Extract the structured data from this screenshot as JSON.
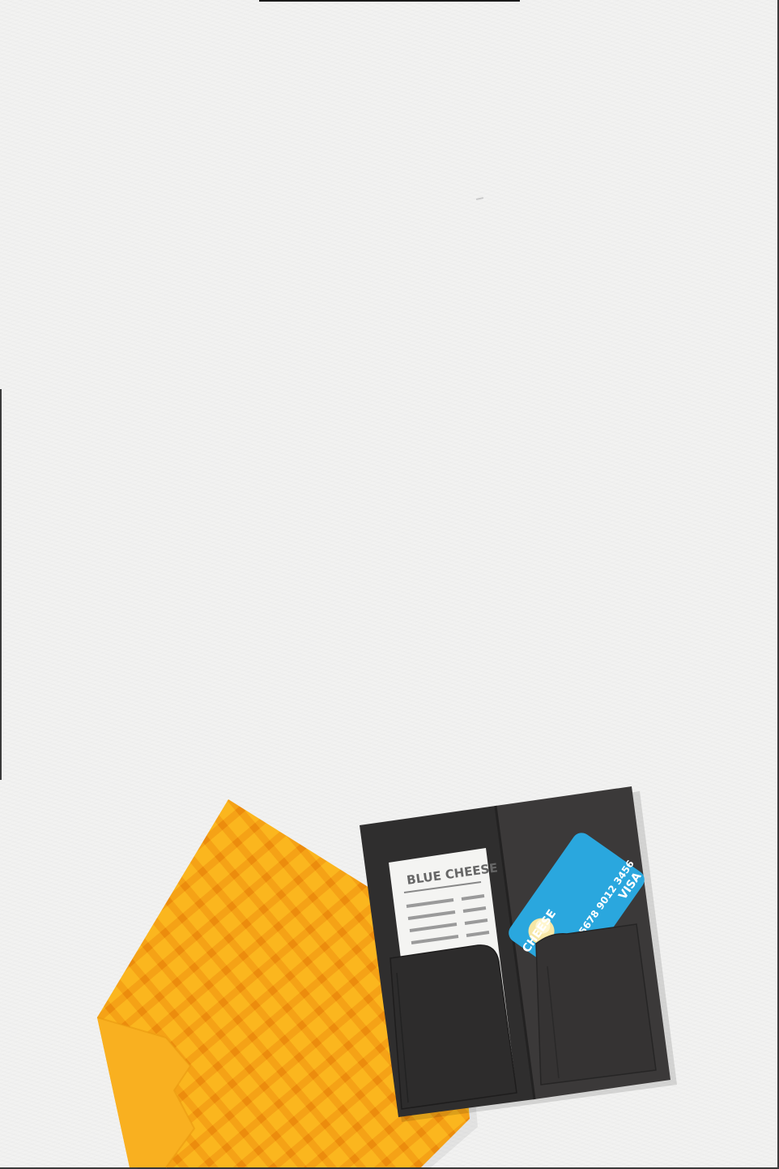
{
  "illustration": {
    "receipt_title": "BLUE CHEESE",
    "card": {
      "brand_text": "CHEESE",
      "number": "5678 9012 3456",
      "network": "VISA"
    },
    "colors": {
      "napkin": "#fab41f",
      "napkin_stripe": "#f09a13",
      "folder_dark": "#2e2d2d",
      "folder_mid": "#3a3838",
      "card_blue": "#2aa7de",
      "receipt": "#f4f4f2"
    }
  }
}
